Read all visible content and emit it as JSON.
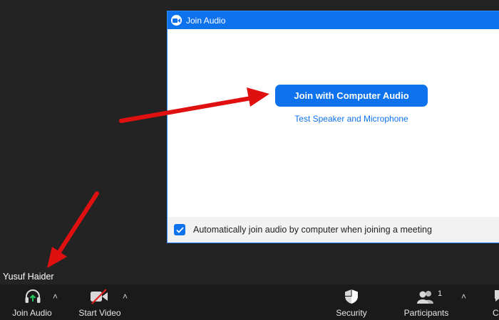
{
  "dialog": {
    "title": "Join Audio",
    "join_button_label": "Join with Computer Audio",
    "test_link_label": "Test Speaker and Microphone",
    "auto_join": {
      "label": "Automatically join audio by computer when joining a meeting",
      "checked": true
    }
  },
  "participant": {
    "name": "Yusuf Haider"
  },
  "toolbar": {
    "join_audio_label": "Join Audio",
    "start_video_label": "Start Video",
    "security_label": "Security",
    "participants_label": "Participants",
    "participants_count": "1",
    "chat_label_partial": "C"
  },
  "icons": {
    "dialog_logo": "video-camera-icon",
    "join_audio": "headphones-icon",
    "start_video": "video-off-icon",
    "security": "shield-icon",
    "participants": "people-icon",
    "caret": "caret-up-icon",
    "checkbox": "check-icon"
  },
  "colors": {
    "zoom_blue": "#0e72ed",
    "background": "#232323",
    "toolbar": "#1a1a1a",
    "annotation_arrow": "#e01010",
    "audio_icon_green": "#22c55e",
    "video_off_red": "#e02020"
  }
}
